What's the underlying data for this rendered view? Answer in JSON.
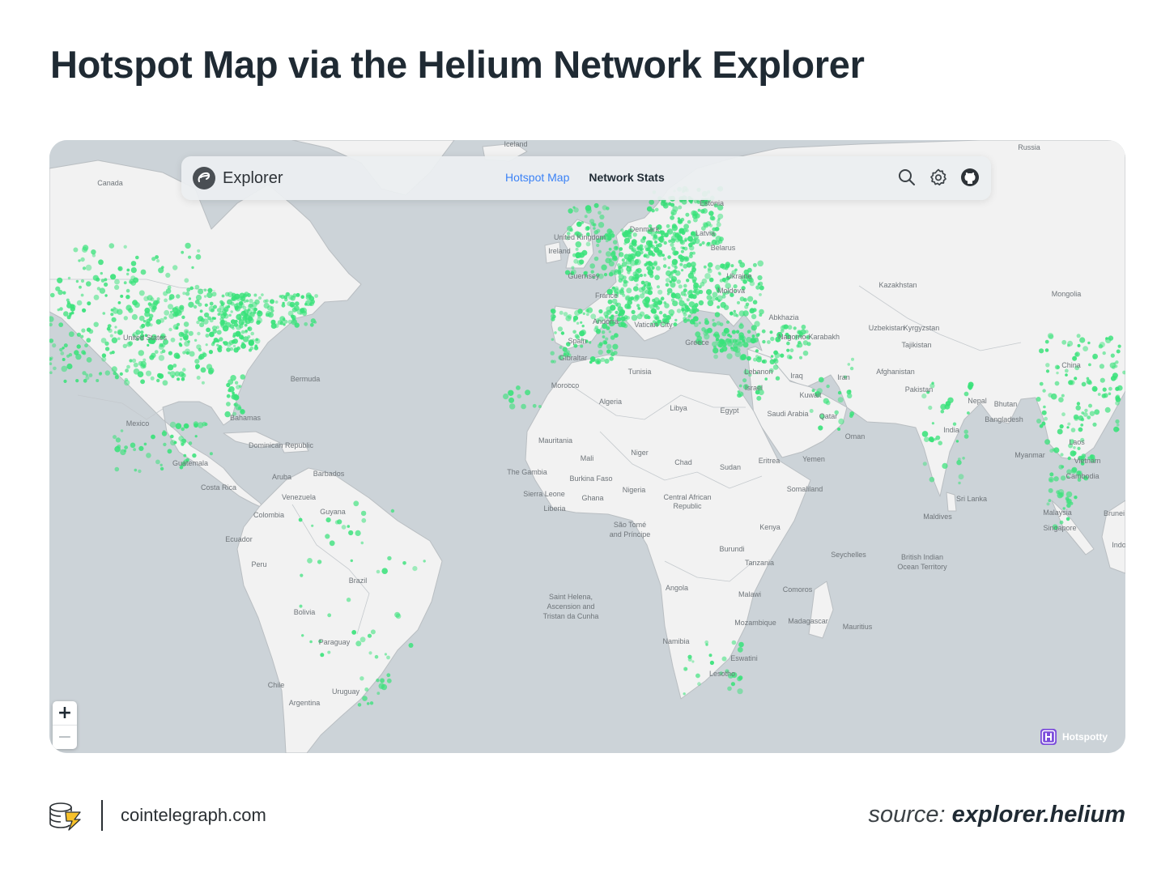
{
  "headline": "Hotspot Map via the Helium Network Explorer",
  "header": {
    "app_name": "Explorer",
    "nav": [
      {
        "label": "Hotspot Map",
        "active": true
      },
      {
        "label": "Network Stats",
        "active": false
      }
    ],
    "tools": [
      "search-icon",
      "gear-icon",
      "github-icon"
    ]
  },
  "map": {
    "colors": {
      "ocean": "#ccd3d8",
      "land": "#f2f2f2",
      "border": "#b9bec2",
      "hotspot": "#39e27a"
    },
    "labels": {
      "iceland": "Iceland",
      "russia": "Russia",
      "canada": "Canada",
      "estonia": "Estonia",
      "uk": "United Kingdom",
      "ireland": "Ireland",
      "denmark": "Denmark",
      "latvia": "Latvia",
      "belarus": "Belarus",
      "guernsey": "Guernsey",
      "ukraine": "Ukraine",
      "france": "France",
      "moldova": "Moldova",
      "kazakhstan": "Kazakhstan",
      "mongolia": "Mongolia",
      "abkhazia": "Abkhazia",
      "andorra": "Andorra",
      "vatican": "Vatican City",
      "spain": "Spain",
      "uzbekistan": "Uzbekistan",
      "kyrgyzstan": "Kyrgyzstan",
      "nagorno": "Nagorno-Karabakh",
      "tajikistan": "Tajikistan",
      "us": "United States",
      "greece": "Greece",
      "gibraltar": "Gibraltar",
      "china": "China",
      "afghanistan": "Afghanistan",
      "iran": "Iran",
      "iraq": "Iraq",
      "lebanon": "Lebanon",
      "tunisia": "Tunisia",
      "bermuda": "Bermuda",
      "morocco": "Morocco",
      "israel": "Israel",
      "pakistan": "Pakistan",
      "kuwait": "Kuwait",
      "nepal": "Nepal",
      "bhutan": "Bhutan",
      "algeria": "Algeria",
      "libya": "Libya",
      "egypt": "Egypt",
      "saudi": "Saudi Arabia",
      "qatar": "Qatar",
      "bahamas": "Bahamas",
      "bangladesh": "Bangladesh",
      "mexico": "Mexico",
      "india": "India",
      "oman": "Oman",
      "mauritania": "Mauritania",
      "laos": "Laos",
      "dominican": "Dominican Republic",
      "myanmar": "Myanmar",
      "mali": "Mali",
      "niger": "Niger",
      "chad": "Chad",
      "eritrea": "Eritrea",
      "yemen": "Yemen",
      "vietnam": "Vietnam",
      "guatemala": "Guatemala",
      "sudan": "Sudan",
      "gambia": "The Gambia",
      "aruba": "Aruba",
      "barbados": "Barbados",
      "burkina": "Burkina Faso",
      "cambodia": "Cambodia",
      "costarica": "Costa Rica",
      "nigeria": "Nigeria",
      "somaliland": "Somaliland",
      "venezuela": "Venezuela",
      "sierra": "Sierra Leone",
      "ghana": "Ghana",
      "car1": "Central African",
      "car2": "Republic",
      "srilanka": "Sri Lanka",
      "liberia": "Liberia",
      "guyana": "Guyana",
      "colombia": "Colombia",
      "malaysia": "Malaysia",
      "brunei": "Brunei",
      "maldives": "Maldives",
      "saotome1": "São Tomé",
      "saotome2": "and Príncipe",
      "kenya": "Kenya",
      "singapore": "Singapore",
      "ecuador": "Ecuador",
      "indo": "Indo",
      "burundi": "Burundi",
      "seychelles": "Seychelles",
      "biot1": "British Indian",
      "biot2": "Ocean Territory",
      "peru": "Peru",
      "tanzania": "Tanzania",
      "brazil": "Brazil",
      "angola": "Angola",
      "comoros": "Comoros",
      "malawi": "Malawi",
      "sainthelena1": "Saint Helena,",
      "sainthelena2": "Ascension and",
      "sainthelena3": "Tristan da Cunha",
      "bolivia": "Bolivia",
      "mozambique": "Mozambique",
      "madagascar": "Madagascar",
      "mauritius": "Mauritius",
      "paraguay": "Paraguay",
      "namibia": "Namibia",
      "eswatini": "Eswatini",
      "lesotho": "Lesotho",
      "chile": "Chile",
      "uruguay": "Uruguay",
      "argentina": "Argentina"
    }
  },
  "zoom": {
    "in": "+",
    "out": "−"
  },
  "attribution": "Hotspotty",
  "footer": {
    "domain": "cointelegraph.com",
    "source_prefix": "source:",
    "source_value": "explorer.helium"
  }
}
